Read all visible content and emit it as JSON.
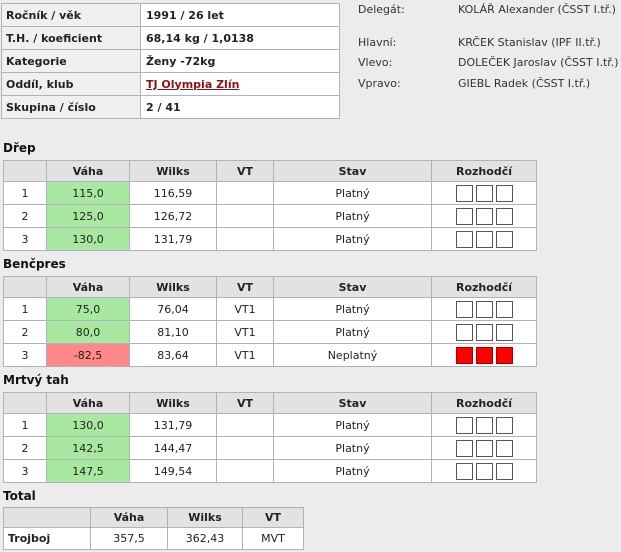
{
  "info": [
    {
      "label": "Ročník / věk",
      "value": "1991 / 26 let",
      "link": false
    },
    {
      "label": "T.H. / koeficient",
      "value": "68,14 kg / 1,0138",
      "link": false
    },
    {
      "label": "Kategorie",
      "value": "Ženy -72kg",
      "link": false
    },
    {
      "label": "Oddíl, klub",
      "value": "TJ Olympia Zlín",
      "link": true
    },
    {
      "label": "Skupina / číslo",
      "value": "2 / 41",
      "link": false
    }
  ],
  "referees": [
    {
      "label": "Delegát:",
      "name": "KOLÁŘ Alexander (ČSST I.tř.)"
    },
    {
      "label": "Hlavní:",
      "name": "KRČEK Stanislav (IPF II.tř.)"
    },
    {
      "label": "Vlevo:",
      "name": "DOLEČEK Jaroslav (ČSST I.tř.)"
    },
    {
      "label": "Vpravo:",
      "name": "GIEBL Radek (ČSST I.tř.)"
    }
  ],
  "columns": {
    "vaha": "Váha",
    "wilks": "Wilks",
    "vt": "VT",
    "stav": "Stav",
    "rozhodci": "Rozhodčí"
  },
  "colors": {
    "valid": "#a8e8a0",
    "invalid": "#ff8888",
    "jury_red": "#ff0000"
  },
  "sections": [
    {
      "title": "Dřep",
      "rows": [
        {
          "no": "1",
          "weight": "115,0",
          "wilks": "116,59",
          "vt": "",
          "status": "Platný",
          "valid": true
        },
        {
          "no": "2",
          "weight": "125,0",
          "wilks": "126,72",
          "vt": "",
          "status": "Platný",
          "valid": true
        },
        {
          "no": "3",
          "weight": "130,0",
          "wilks": "131,79",
          "vt": "",
          "status": "Platný",
          "valid": true
        }
      ]
    },
    {
      "title": "Benčpres",
      "rows": [
        {
          "no": "1",
          "weight": "75,0",
          "wilks": "76,04",
          "vt": "VT1",
          "status": "Platný",
          "valid": true
        },
        {
          "no": "2",
          "weight": "80,0",
          "wilks": "81,10",
          "vt": "VT1",
          "status": "Platný",
          "valid": true
        },
        {
          "no": "3",
          "weight": "-82,5",
          "wilks": "83,64",
          "vt": "VT1",
          "status": "Neplatný",
          "valid": false
        }
      ]
    },
    {
      "title": "Mrtvý tah",
      "rows": [
        {
          "no": "1",
          "weight": "130,0",
          "wilks": "131,79",
          "vt": "",
          "status": "Platný",
          "valid": true
        },
        {
          "no": "2",
          "weight": "142,5",
          "wilks": "144,47",
          "vt": "",
          "status": "Platný",
          "valid": true
        },
        {
          "no": "3",
          "weight": "147,5",
          "wilks": "149,54",
          "vt": "",
          "status": "Platný",
          "valid": true
        }
      ]
    }
  ],
  "total": {
    "title": "Total",
    "label": "Trojboj",
    "vaha": "357,5",
    "wilks": "362,43",
    "vt": "MVT"
  }
}
